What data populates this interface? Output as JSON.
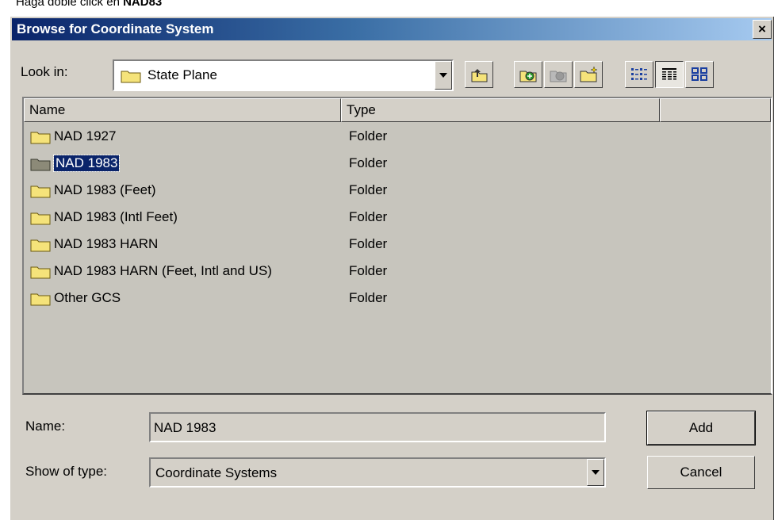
{
  "caption": {
    "prefix": "Haga doble click en ",
    "bold": "NAD83"
  },
  "dialog": {
    "title": "Browse for Coordinate System",
    "close_label": "×",
    "look_in_label": "Look in:",
    "look_in_value": "State Plane",
    "toolbar": [
      "up-one-level",
      "connect-to-folder",
      "disconnect-folder",
      "new-folder",
      "list-view",
      "details-view",
      "thumbnails-view"
    ],
    "columns": [
      "Name",
      "Type",
      ""
    ],
    "rows": [
      {
        "name": "NAD 1927",
        "type": "Folder"
      },
      {
        "name": "NAD 1983",
        "type": "Folder"
      },
      {
        "name": "NAD 1983 (Feet)",
        "type": "Folder"
      },
      {
        "name": "NAD 1983 (Intl Feet)",
        "type": "Folder"
      },
      {
        "name": "NAD 1983 HARN",
        "type": "Folder"
      },
      {
        "name": "NAD 1983 HARN (Feet, Intl and US)",
        "type": "Folder"
      },
      {
        "name": "Other GCS",
        "type": "Folder"
      }
    ],
    "selected_row": "NAD 1983",
    "name_label": "Name:",
    "name_value": "NAD 1983",
    "type_label": "Show of type:",
    "type_value": "Coordinate Systems",
    "add_label": "Add",
    "cancel_label": "Cancel"
  },
  "colors": {
    "title_gradient_start": "#0a246a",
    "selection": "#0a246a",
    "face": "#d4d0c8"
  }
}
